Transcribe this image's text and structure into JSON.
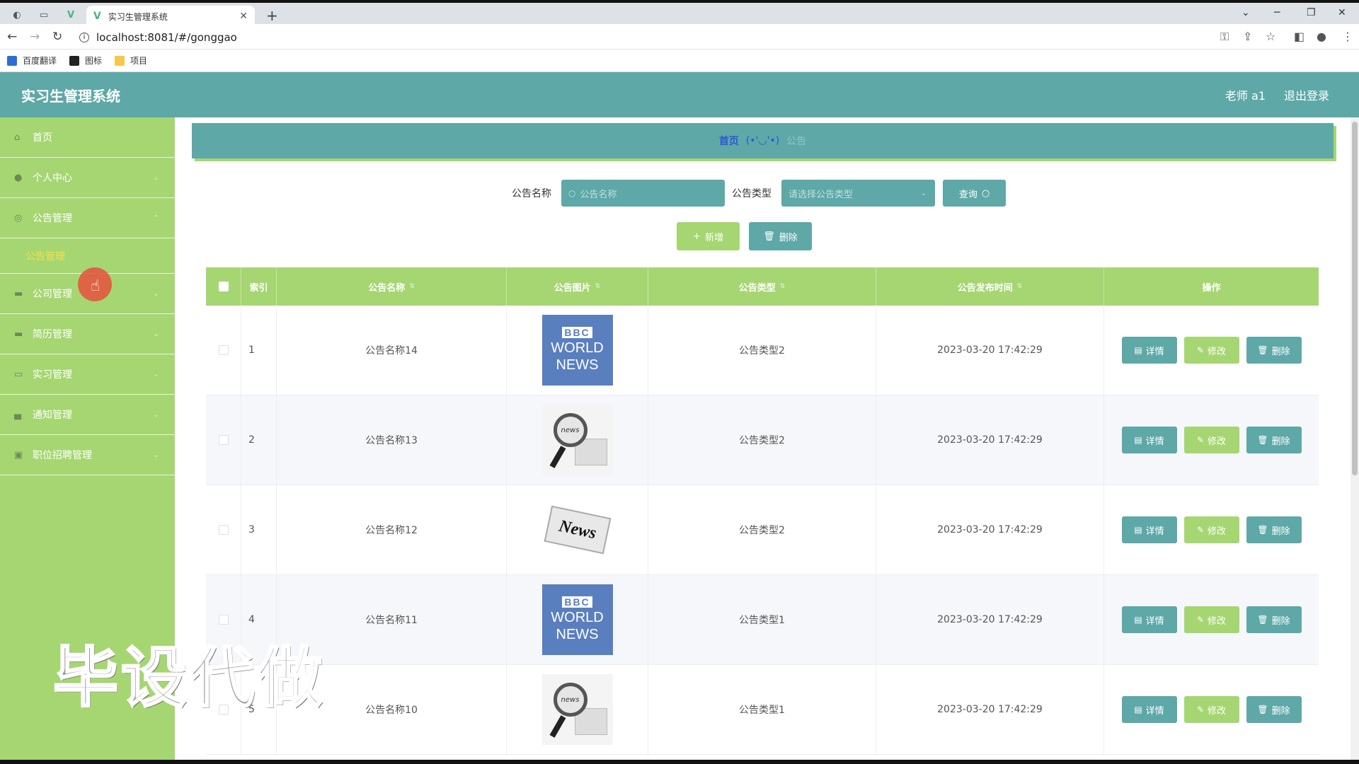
{
  "browser": {
    "tab_title": "实习生管理系统",
    "url": "localhost:8081/#/gonggao",
    "bookmarks": [
      "百度翻译",
      "图标",
      "项目"
    ]
  },
  "header": {
    "title": "实习生管理系统",
    "user": "老师 a1",
    "logout": "退出登录"
  },
  "sidebar": {
    "items": [
      {
        "label": "首页",
        "icon": "home-icon"
      },
      {
        "label": "个人中心",
        "icon": "user-icon"
      },
      {
        "label": "公告管理",
        "icon": "globe-icon"
      },
      {
        "label": "公司管理",
        "icon": "monitor-icon"
      },
      {
        "label": "简历管理",
        "icon": "monitor-icon"
      },
      {
        "label": "实习管理",
        "icon": "chat-icon"
      },
      {
        "label": "通知管理",
        "icon": "printer-icon"
      },
      {
        "label": "职位招聘管理",
        "icon": "checkbox-icon"
      }
    ],
    "sub_item": "公告管理"
  },
  "breadcrumb": {
    "home": "首页",
    "sep": "(•'◡'•)",
    "current": "公告"
  },
  "search": {
    "name_label": "公告名称",
    "name_placeholder": "公告名称",
    "type_label": "公告类型",
    "type_placeholder": "请选择公告类型",
    "query": "查询"
  },
  "actions": {
    "add": "新增",
    "delete": "删除"
  },
  "table": {
    "headers": [
      "索引",
      "公告名称",
      "公告图片",
      "公告类型",
      "公告发布时间",
      "操作"
    ],
    "rows": [
      {
        "index": "1",
        "name": "公告名称14",
        "image": "bbc",
        "type": "公告类型2",
        "time": "2023-03-20 17:42:29"
      },
      {
        "index": "2",
        "name": "公告名称13",
        "image": "magnifier",
        "type": "公告类型2",
        "time": "2023-03-20 17:42:29"
      },
      {
        "index": "3",
        "name": "公告名称12",
        "image": "news",
        "type": "公告类型2",
        "time": "2023-03-20 17:42:29"
      },
      {
        "index": "4",
        "name": "公告名称11",
        "image": "bbc",
        "type": "公告类型1",
        "time": "2023-03-20 17:42:29"
      },
      {
        "index": "5",
        "name": "公告名称10",
        "image": "magnifier",
        "type": "公告类型1",
        "time": "2023-03-20 17:42:29"
      }
    ],
    "ops": {
      "detail": "详情",
      "edit": "修改",
      "delete": "删除"
    }
  },
  "images": {
    "bbc_top": "BBC",
    "bbc_line1": "WORLD",
    "bbc_line2": "NEWS",
    "mag_text": "news",
    "news_text": "News"
  },
  "watermark": "毕设代做",
  "colors": {
    "teal": "#5ea8a7",
    "green": "#a6d672",
    "yellow": "#f5e04a"
  }
}
